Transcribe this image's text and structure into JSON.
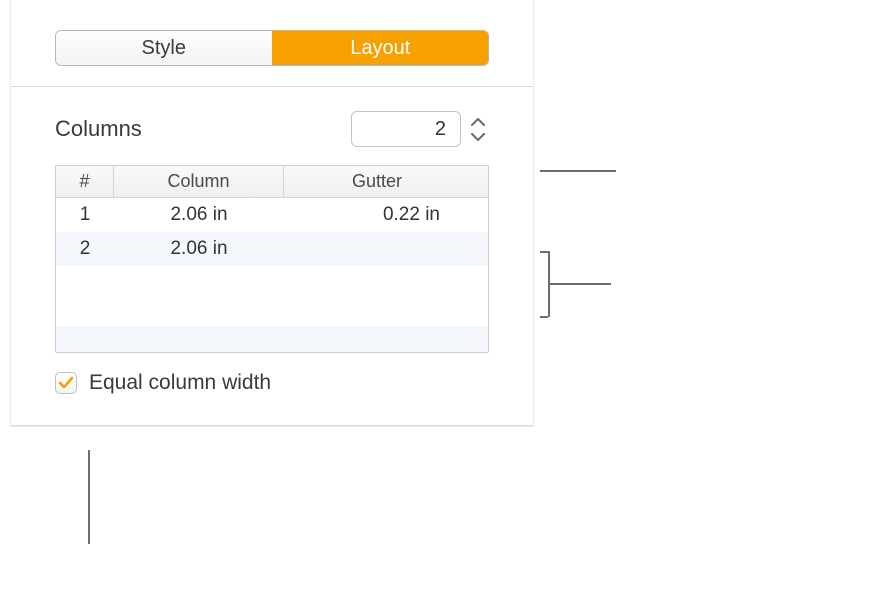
{
  "tabs": {
    "style": "Style",
    "layout": "Layout",
    "active": "layout"
  },
  "columns": {
    "label": "Columns",
    "count": "2",
    "table": {
      "headers": {
        "num": "#",
        "column": "Column",
        "gutter": "Gutter"
      },
      "rows": [
        {
          "num": "1",
          "column": "2.06 in",
          "gutter": "0.22 in"
        },
        {
          "num": "2",
          "column": "2.06 in",
          "gutter": ""
        }
      ]
    },
    "equal_label": "Equal column width",
    "equal_checked": true
  },
  "colors": {
    "accent": "#f7a100"
  }
}
